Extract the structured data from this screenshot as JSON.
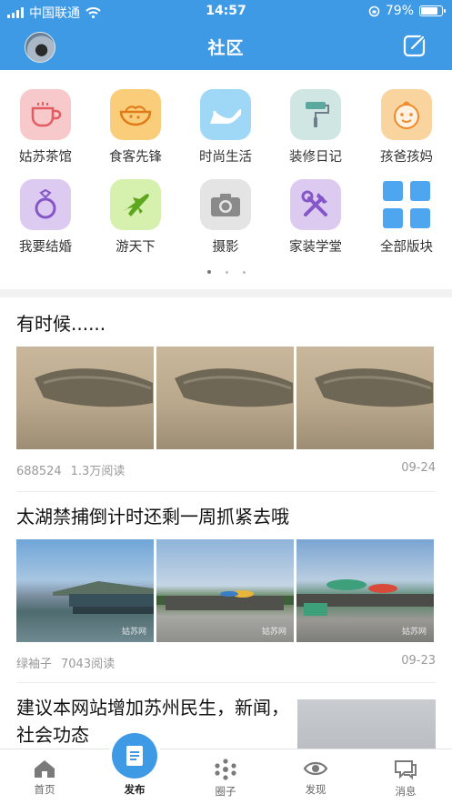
{
  "status_bar": {
    "carrier": "中国联通",
    "time": "14:57",
    "battery": "79%"
  },
  "header": {
    "title": "社区"
  },
  "categories": [
    {
      "label": "姑苏茶馆",
      "icon": "teacup-icon",
      "color": "#f7c9cb"
    },
    {
      "label": "食客先锋",
      "icon": "food-bowl-icon",
      "color": "#f9cd7a"
    },
    {
      "label": "时尚生活",
      "icon": "high-heel-icon",
      "color": "#9fd8f6"
    },
    {
      "label": "装修日记",
      "icon": "paint-roller-icon",
      "color": "#cfe6e3"
    },
    {
      "label": "孩爸孩妈",
      "icon": "baby-face-icon",
      "color": "#f9d49e"
    },
    {
      "label": "我要结婚",
      "icon": "ring-icon",
      "color": "#dccaf0"
    },
    {
      "label": "游天下",
      "icon": "airplane-icon",
      "color": "#d6f0ad"
    },
    {
      "label": "摄影",
      "icon": "camera-icon",
      "color": "#e4e4e4"
    },
    {
      "label": "家装学堂",
      "icon": "tools-icon",
      "color": "#dccaf0"
    },
    {
      "label": "全部版块",
      "icon": "grid-icon",
      "color": "#4fa6f0"
    }
  ],
  "posts": [
    {
      "title": "有时候......",
      "author": "688524",
      "reads": "1.3万阅读",
      "date": "09-24"
    },
    {
      "title": "太湖禁捕倒计时还剩一周抓紧去哦",
      "author": "绿袖子",
      "reads": "7043阅读",
      "date": "09-23",
      "watermark": "姑苏网"
    },
    {
      "title": "建议本网站增加苏州民生，新闻，社会功态"
    }
  ],
  "tabs": [
    {
      "label": "首页",
      "icon": "home-icon"
    },
    {
      "label": "发布",
      "icon": "publish-icon"
    },
    {
      "label": "圈子",
      "icon": "circle-dots-icon"
    },
    {
      "label": "发现",
      "icon": "eye-icon"
    },
    {
      "label": "消息",
      "icon": "message-icon"
    }
  ],
  "colors": {
    "brand": "#3f9ae6"
  }
}
